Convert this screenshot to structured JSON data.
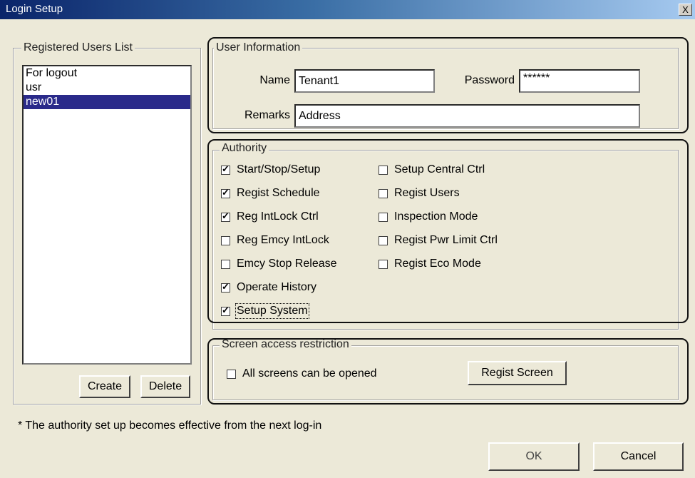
{
  "window": {
    "title": "Login Setup",
    "close_label": "X"
  },
  "users": {
    "group_label": "Registered Users List",
    "items": [
      "For logout",
      "usr",
      "new01"
    ],
    "selected": "new01",
    "create_label": "Create",
    "delete_label": "Delete"
  },
  "user_info": {
    "group_label": "User Information",
    "name_label": "Name",
    "name_value": "Tenant1",
    "password_label": "Password",
    "password_value": "******",
    "remarks_label": "Remarks",
    "remarks_value": "Address"
  },
  "authority": {
    "group_label": "Authority",
    "left": [
      {
        "label": "Start/Stop/Setup",
        "checked": true
      },
      {
        "label": "Regist Schedule",
        "checked": true
      },
      {
        "label": "Reg IntLock Ctrl",
        "checked": true
      },
      {
        "label": "Reg Emcy IntLock",
        "checked": false
      },
      {
        "label": "Emcy Stop Release",
        "checked": false
      },
      {
        "label": "Operate History",
        "checked": true
      },
      {
        "label": "Setup System",
        "checked": true
      }
    ],
    "right": [
      {
        "label": "Setup Central Ctrl",
        "checked": false
      },
      {
        "label": "Regist Users",
        "checked": false
      },
      {
        "label": "Inspection Mode",
        "checked": false
      },
      {
        "label": "Regist Pwr Limit Ctrl",
        "checked": false
      },
      {
        "label": "Regist Eco Mode",
        "checked": false
      }
    ]
  },
  "screen_access": {
    "group_label": "Screen access restriction",
    "all_screens_label": "All screens can be opened",
    "all_screens_checked": false,
    "regist_screen_label": "Regist Screen"
  },
  "footer": {
    "note": "* The authority set up becomes effective from the next log-in",
    "ok_label": "OK",
    "cancel_label": "Cancel"
  }
}
